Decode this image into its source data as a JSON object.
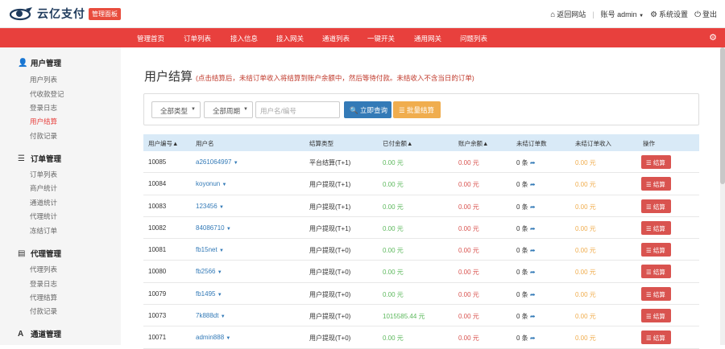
{
  "header": {
    "logo_text": "云亿支付",
    "badge": "管理面板",
    "links": {
      "back_site": "返回网站",
      "account_label": "账号 admin",
      "settings": "系统设置",
      "logout": "登出"
    }
  },
  "nav": {
    "items": [
      "管理首页",
      "订单列表",
      "接入信息",
      "接入网关",
      "通道列表",
      "一键开关",
      "通用网关",
      "问题列表"
    ]
  },
  "sidebar": {
    "groups": [
      {
        "title": "用户管理",
        "icon": "user-icon",
        "items": [
          "用户列表",
          "代收款登记",
          "登录日志",
          "用户结算",
          "付款记录"
        ]
      },
      {
        "title": "订单管理",
        "icon": "list-icon",
        "items": [
          "订单列表",
          "商户统计",
          "通道统计",
          "代理统计",
          "冻结订单"
        ]
      },
      {
        "title": "代理管理",
        "icon": "file-icon",
        "items": [
          "代理列表",
          "登录日志",
          "代理结算",
          "付款记录"
        ]
      },
      {
        "title": "通道管理",
        "icon": "font-icon",
        "items": []
      }
    ],
    "active_item": "用户结算"
  },
  "page": {
    "title": "用户结算",
    "hint": "(点击结算后，未结订单收入将结算到账户余额中，然后等待付款。未结收入不含当日的订单)"
  },
  "filters": {
    "type_select": "全部类型",
    "period_select": "全部周期",
    "search_placeholder": "用户名/编号",
    "query_button": "立即查询",
    "batch_button": "批量结算"
  },
  "table": {
    "columns": [
      "用户编号▲",
      "用户名",
      "结算类型",
      "已付金额▲",
      "账户余额▲",
      "未结订单数",
      "未结订单收入",
      "操作"
    ],
    "settle_label": "结算",
    "rows": [
      {
        "id": "10085",
        "user": "a261064997",
        "type": "平台结算(T+1)",
        "paid": "0.00 元",
        "balance": "0.00 元",
        "orders": "0 条",
        "income": "0.00 元"
      },
      {
        "id": "10084",
        "user": "koyonun",
        "type": "用户提现(T+1)",
        "paid": "0.00 元",
        "balance": "0.00 元",
        "orders": "0 条",
        "income": "0.00 元"
      },
      {
        "id": "10083",
        "user": "123456",
        "type": "用户提现(T+1)",
        "paid": "0.00 元",
        "balance": "0.00 元",
        "orders": "0 条",
        "income": "0.00 元"
      },
      {
        "id": "10082",
        "user": "84086710",
        "type": "用户提现(T+1)",
        "paid": "0.00 元",
        "balance": "0.00 元",
        "orders": "0 条",
        "income": "0.00 元"
      },
      {
        "id": "10081",
        "user": "fb15net",
        "type": "用户提现(T+0)",
        "paid": "0.00 元",
        "balance": "0.00 元",
        "orders": "0 条",
        "income": "0.00 元"
      },
      {
        "id": "10080",
        "user": "fb2566",
        "type": "用户提现(T+0)",
        "paid": "0.00 元",
        "balance": "0.00 元",
        "orders": "0 条",
        "income": "0.00 元"
      },
      {
        "id": "10079",
        "user": "fb1495",
        "type": "用户提现(T+0)",
        "paid": "0.00 元",
        "balance": "0.00 元",
        "orders": "0 条",
        "income": "0.00 元"
      },
      {
        "id": "10073",
        "user": "7k888dt",
        "type": "用户提现(T+0)",
        "paid": "1015585.44 元",
        "balance": "0.00 元",
        "orders": "0 条",
        "income": "0.00 元"
      },
      {
        "id": "10071",
        "user": "admin888",
        "type": "用户提现(T+0)",
        "paid": "0.00 元",
        "balance": "0.00 元",
        "orders": "0 条",
        "income": "0.00 元"
      }
    ]
  },
  "colors": {
    "brand_red": "#e8403d",
    "primary_blue": "#337ab7",
    "warning_orange": "#f0ad4e",
    "danger_red": "#d9534f",
    "success_green": "#5cb85c"
  }
}
